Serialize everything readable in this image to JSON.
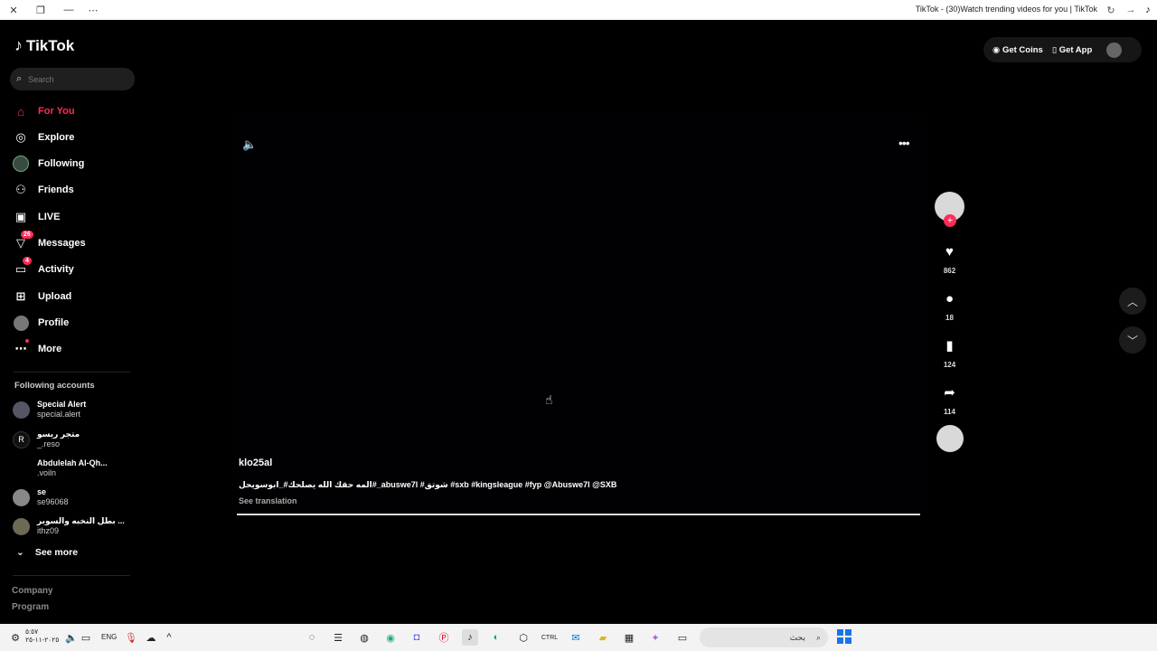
{
  "browser": {
    "title": "TikTok - (30)Watch trending videos for you | TikTok"
  },
  "sidebar": {
    "logo": "TikTok",
    "search_placeholder": "Search",
    "nav": [
      {
        "label": "For You",
        "icon": "home-icon"
      },
      {
        "label": "Explore",
        "icon": "compass-icon"
      },
      {
        "label": "Following",
        "icon": "following-avatar-icon"
      },
      {
        "label": "Friends",
        "icon": "friends-icon"
      },
      {
        "label": "LIVE",
        "icon": "live-icon"
      },
      {
        "label": "Messages",
        "icon": "messages-icon",
        "badge": "26"
      },
      {
        "label": "Activity",
        "icon": "activity-icon",
        "badge": "4"
      },
      {
        "label": "Upload",
        "icon": "upload-icon"
      },
      {
        "label": "Profile",
        "icon": "profile-icon"
      },
      {
        "label": "More",
        "icon": "more-icon"
      }
    ],
    "following_title": "Following accounts",
    "accounts": [
      {
        "name": "Special Alert",
        "handle": "special.alert"
      },
      {
        "name": "متجر ريسو",
        "handle": "_.reso"
      },
      {
        "name": "Abdulelah Al-Qh...",
        "handle": ".voiln"
      },
      {
        "name": "se",
        "handle": "se96068"
      },
      {
        "name": "بطل النخبه والسوبر ...",
        "handle": "ithz09"
      }
    ],
    "see_more": "See more",
    "footer": [
      "Company",
      "Program"
    ]
  },
  "video": {
    "author": "klo25al",
    "caption": "المه حقك الله يصلحك#_ابوسويحل#_abuswe7l #شوتق #sxb #kingsleague #fyp @Abuswe7l @SXB",
    "translate": "See translation",
    "progress": 1.0
  },
  "actions": {
    "likes": "862",
    "comments": "18",
    "saves": "124",
    "shares": "114"
  },
  "header": {
    "coins": "Get Coins",
    "app": "Get App"
  },
  "taskbar": {
    "time": "٥:٥٧",
    "date": "٢٠٢٥-١١-٢٥",
    "lang": "ENG",
    "search_placeholder": "بحث"
  }
}
